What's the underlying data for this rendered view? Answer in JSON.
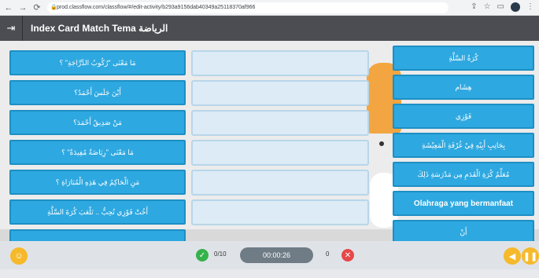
{
  "browser": {
    "url": "prod.classflow.com/classflow/#/edit-activity/b293a9156dab40349a25118370af966"
  },
  "appbar": {
    "title": "Index Card Match Tema الرياضة"
  },
  "questions": [
    "مَا مَعْنَى \"رُكُوبُ الدَّرَّاجَةِ\" ؟",
    "أَيْنَ جَلَسَ أَحْمَدُ؟",
    "مَنْ صَدِيقُ أَحْمَدَ؟",
    "مَا مَعْنَى \"رِيَاضَةٌ مُفِيدَةٌ\" ؟",
    "مَنِ الْحَاكِمُ فِي هَذِهِ الْمُبَارَاةِ ؟",
    "أَخُتْ فَوْزِي تُحِبُّ .. تَلْعَبَ كُرَةَ السَّلَّةِ",
    "..."
  ],
  "answers": [
    {
      "text": "كُرَةُ السَّلَّةِ",
      "latin": false
    },
    {
      "text": "هِشَام",
      "latin": false
    },
    {
      "text": "فَوْزِي",
      "latin": false
    },
    {
      "text": "بِجَانِبِ أَبِيْهِ فِيْ غُرْفَةِ الْمَعِيْشَةِ",
      "latin": false
    },
    {
      "text": "مُعَلِّمُ كُرَةِ الْقَدَمِ مِن مَدْرَسَةِ ذَلِكَ",
      "latin": false
    },
    {
      "text": "Olahraga yang bermanfaat",
      "latin": true
    },
    {
      "text": "أَنْ",
      "latin": false
    }
  ],
  "footer": {
    "correct": "0/10",
    "timer": "00:00:26",
    "incorrect": "0"
  }
}
